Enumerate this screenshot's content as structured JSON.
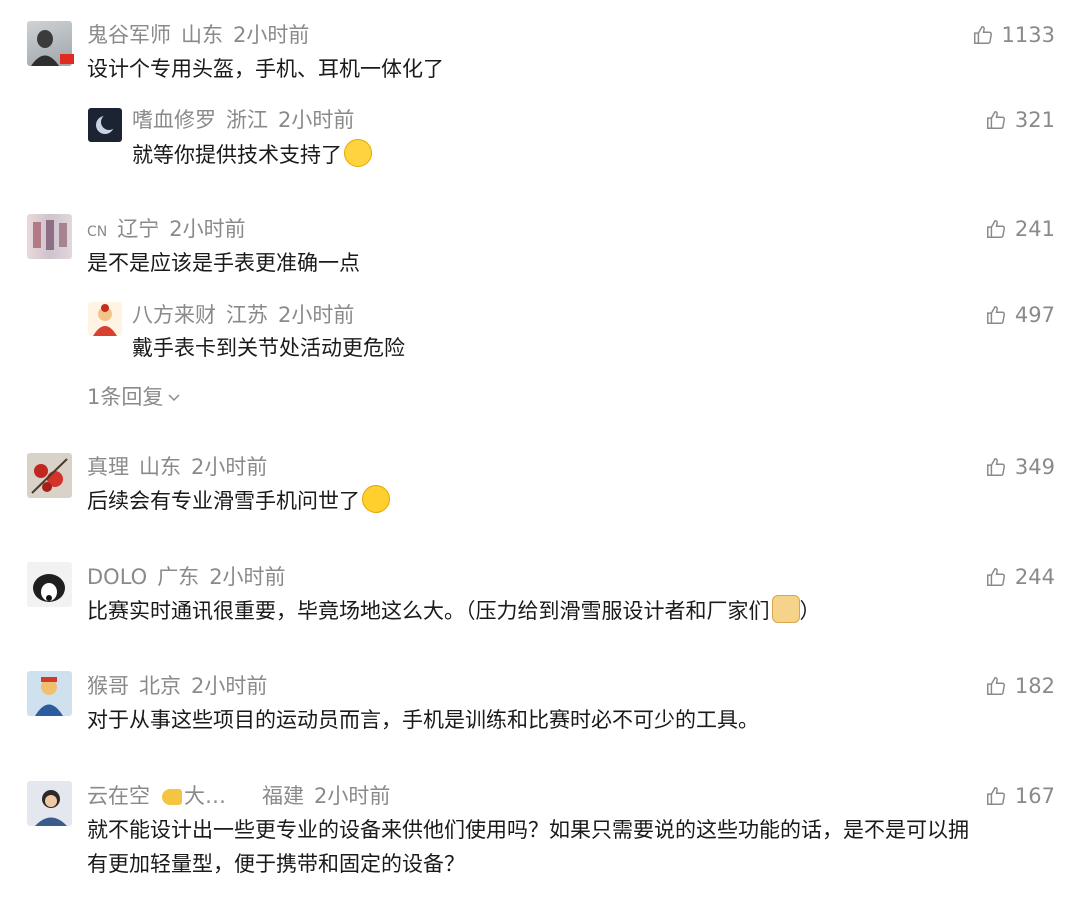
{
  "comments": [
    {
      "name": "鬼谷军师",
      "region": "山东",
      "time": "2小时前",
      "text": "设计个专用头盔，手机、耳机一体化了",
      "likes": "1133"
    },
    {
      "name": "嗜血修罗",
      "region": "浙江",
      "time": "2小时前",
      "text": "就等你提供技术支持了",
      "likes": "321"
    },
    {
      "name": "CN",
      "region": "辽宁",
      "time": "2小时前",
      "text": "是不是应该是手表更准确一点",
      "likes": "241"
    },
    {
      "name": "八方来财",
      "region": "江苏",
      "time": "2小时前",
      "text": "戴手表卡到关节处活动更危险",
      "likes": "497"
    },
    {
      "name": "真理",
      "region": "山东",
      "time": "2小时前",
      "text": "后续会有专业滑雪手机问世了",
      "likes": "349"
    },
    {
      "name": "DOLO",
      "region": "广东",
      "time": "2小时前",
      "text": "比赛实时通讯很重要，毕竟场地这么大。（压力给到滑雪服设计者和厂家们",
      "text_end": "）",
      "likes": "244"
    },
    {
      "name": "猴哥",
      "region": "北京",
      "time": "2小时前",
      "text": "对于从事这些项目的运动员而言，手机是训练和比赛时必不可少的工具。",
      "likes": "182"
    },
    {
      "name": "云在空",
      "name_suffix": "大…",
      "region": "福建",
      "time": "2小时前",
      "text1": "就不能设计出一些更专业的设备来供他们使用吗？如果只需要说的这些功能的话，是不是可以拥",
      "text2": "有更加轻量型，便于携带和固定的设备？",
      "likes": "167"
    }
  ],
  "more_replies": "1条回复"
}
